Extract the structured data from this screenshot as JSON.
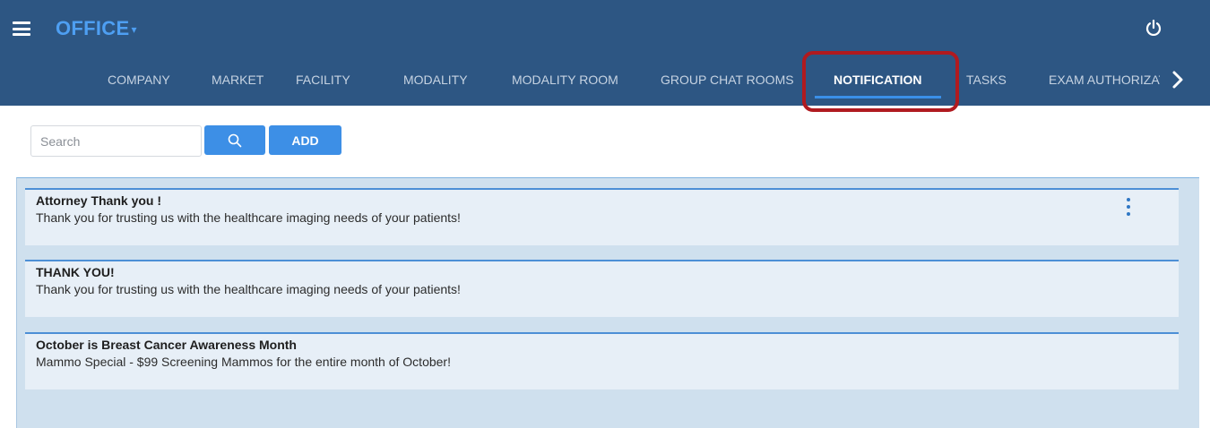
{
  "header": {
    "brand": "OFFICE",
    "brand_caret": "▾"
  },
  "nav": {
    "items": [
      {
        "label": "COMPANY"
      },
      {
        "label": "MARKET"
      },
      {
        "label": "FACILITY"
      },
      {
        "label": "MODALITY"
      },
      {
        "label": "MODALITY ROOM"
      },
      {
        "label": "GROUP CHAT ROOMS"
      },
      {
        "label": "NOTIFICATION",
        "active": true
      },
      {
        "label": "TASKS"
      },
      {
        "label": "EXAM AUTHORIZAT"
      }
    ]
  },
  "toolbar": {
    "search_placeholder": "Search",
    "add_label": "ADD"
  },
  "notifications": [
    {
      "title": "Attorney Thank you !",
      "body": "Thank you for trusting us with the healthcare imaging needs of your patients!"
    },
    {
      "title": "THANK YOU!",
      "body": "Thank you for trusting us with the healthcare imaging needs of your patients!"
    },
    {
      "title": "October is Breast Cancer Awareness Month",
      "body": "Mammo Special - $99 Screening Mammos for the entire month of October!"
    }
  ],
  "colors": {
    "header_bg": "#2d5683",
    "brand": "#4e9ff2",
    "accent": "#3d8fe6",
    "highlight": "#b01a1f",
    "panel_bg": "#cfe0ee",
    "card_bg": "#e7eff7"
  },
  "icons": {
    "menu": "hamburger-menu-icon",
    "power": "power-icon",
    "search": "search-icon",
    "next": "chevron-right-icon",
    "more": "kebab-menu-icon"
  }
}
